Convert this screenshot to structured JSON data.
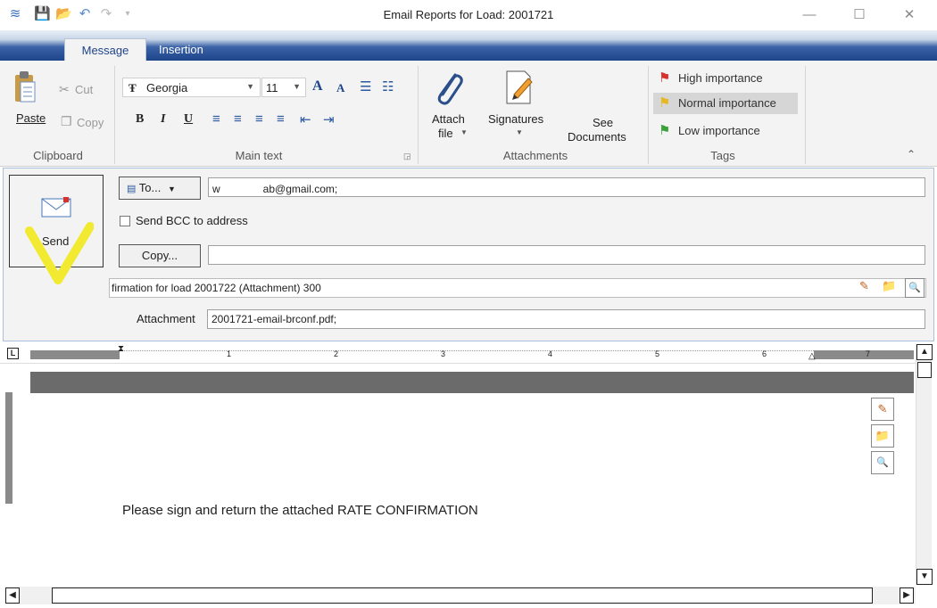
{
  "window": {
    "title": "Email Reports for Load: 2001721",
    "minimize": "—",
    "maximize": "☐",
    "close": "✕"
  },
  "tabs": {
    "message": "Message",
    "insertion": "Insertion"
  },
  "clipboard": {
    "cut": "Cut",
    "copy": "Copy",
    "paste": "Paste",
    "group": "Clipboard"
  },
  "main_text": {
    "font": "Georgia",
    "size": "11",
    "bold": "B",
    "italic": "I",
    "underline": "U",
    "grow": "A",
    "shrink": "A",
    "group": "Main text"
  },
  "attachments": {
    "attach_line1": "Attach",
    "attach_line2": "file",
    "signatures": "Signatures",
    "see_line1": "See",
    "see_line2": "Documents",
    "group": "Attachments"
  },
  "tags": {
    "high": "High importance",
    "normal": "Normal importance",
    "low": "Low importance",
    "group": "Tags",
    "colors": {
      "high": "#d9302c",
      "normal": "#e8b820",
      "low": "#3aa23a"
    }
  },
  "compose": {
    "send": "Send",
    "to_button": "To...",
    "to_prefix": "w",
    "to_value": "ab@gmail.com;",
    "bcc_label": "Send BCC to address",
    "copy_button": "Copy...",
    "copy_value": "",
    "subject": "firmation for load 2001722 (Attachment) 300",
    "attachment_label": "Attachment",
    "attachment_value": "2001721-email-brconf.pdf;"
  },
  "ruler": {
    "marks": [
      "1",
      "2",
      "3",
      "4",
      "5",
      "6",
      "7"
    ]
  },
  "editor": {
    "body": "Please sign and return the attached RATE CONFIRMATION"
  }
}
